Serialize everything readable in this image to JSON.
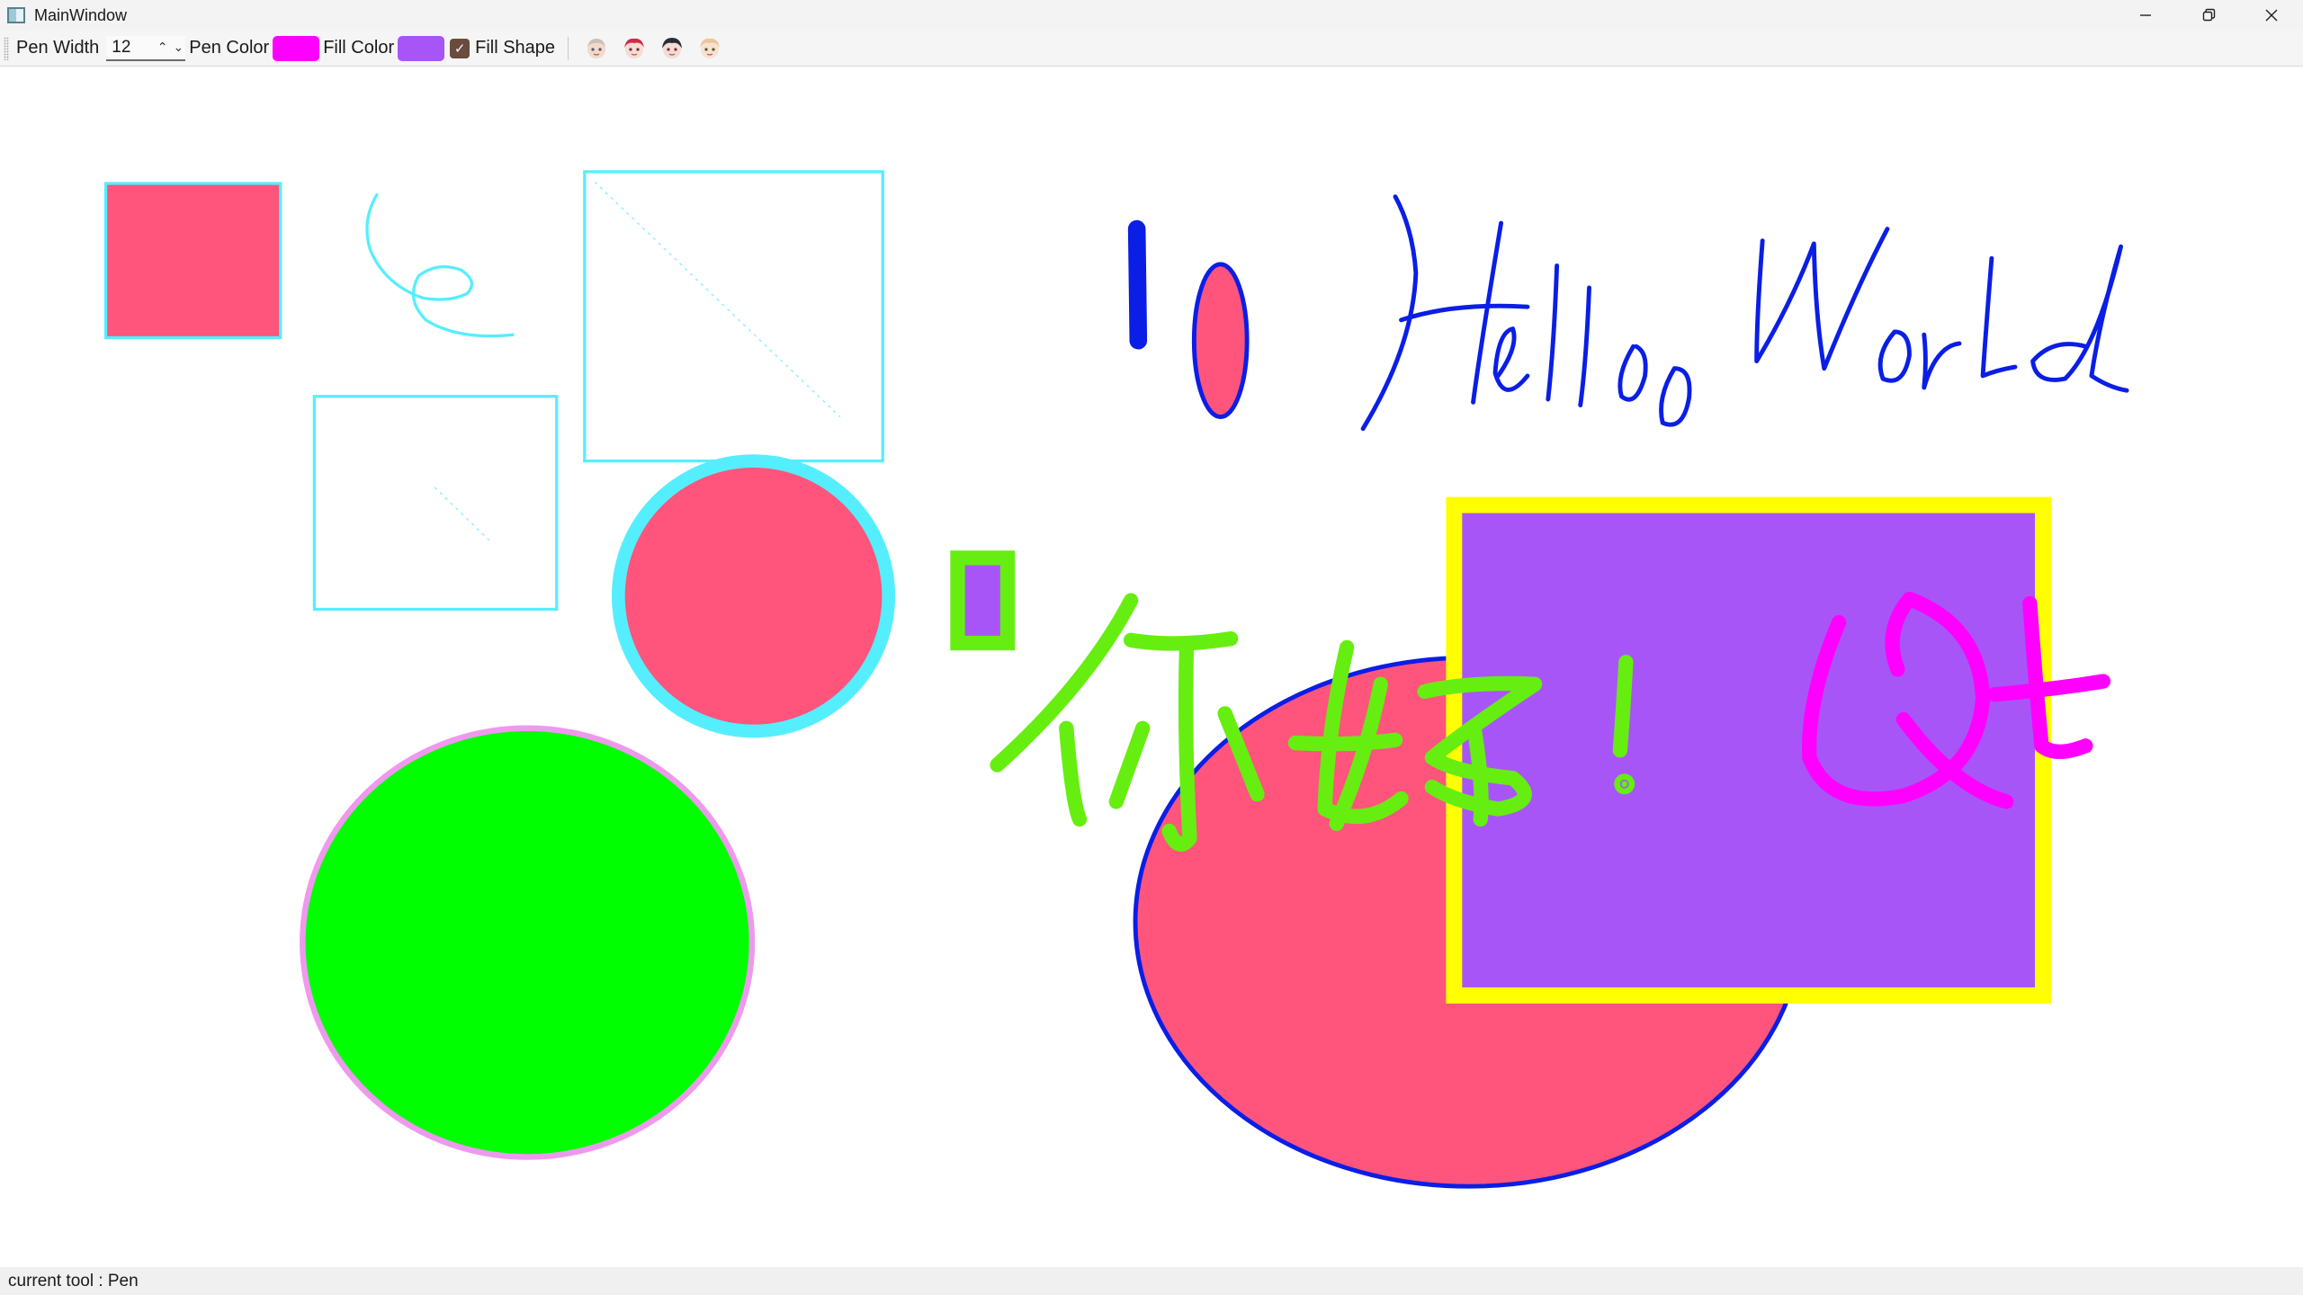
{
  "window": {
    "title": "MainWindow",
    "controls": [
      "minimize-icon",
      "restore-icon",
      "close-icon"
    ]
  },
  "toolbar": {
    "pen_width_label": "Pen Width",
    "pen_width_value": "12",
    "pen_color_label": "Pen Color",
    "pen_color": "#ff00ff",
    "fill_color_label": "Fill Color",
    "fill_color": "#a855f7",
    "fill_shape_label": "Fill Shape",
    "fill_shape_checked": true,
    "tools": [
      "pen-tool-icon",
      "rectangle-tool-icon",
      "ellipse-tool-icon",
      "eraser-tool-icon"
    ]
  },
  "canvas": {
    "texts": [
      "Hello World",
      "你好！",
      "Qt"
    ],
    "colors": {
      "cyan": "#55eeff",
      "pink": "#ff547c",
      "green": "#00ff00",
      "lime": "#66ee11",
      "blue": "#0a1ee6",
      "purple": "#a855f7",
      "yellow": "#ffff00",
      "magenta": "#ff00ff",
      "lavender": "#ee99ee"
    }
  },
  "status": {
    "text": "current tool : Pen"
  }
}
